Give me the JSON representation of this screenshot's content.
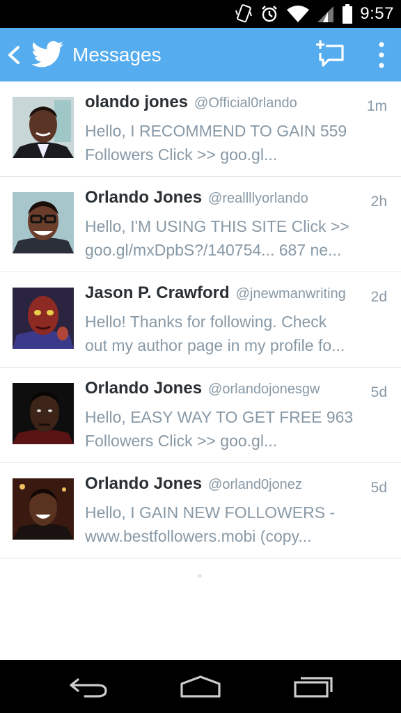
{
  "status_bar": {
    "time": "9:57",
    "icons": [
      "vibrate-icon",
      "alarm-icon",
      "wifi-icon",
      "signal-icon",
      "battery-icon"
    ]
  },
  "app_bar": {
    "title": "Messages",
    "back_icon": "back-chevron-icon",
    "logo_icon": "twitter-bird-icon",
    "compose_icon": "compose-message-icon",
    "overflow_icon": "overflow-menu-icon",
    "color": "#55acee"
  },
  "messages": [
    {
      "name": "olando jones",
      "handle": "@Official0rlando",
      "time": "1m",
      "preview_lines": [
        "Hello, I RECOMMEND TO GAIN 559",
        "Followers Click >> goo.gl..."
      ]
    },
    {
      "name": "Orlando Jones",
      "handle": "@reallllyorlando",
      "time": "2h",
      "preview_lines": [
        "Hello, I'M USING THIS SITE Click >>",
        "goo.gl/mxDpbS?/140754... 687 ne..."
      ]
    },
    {
      "name": "Jason P. Crawford",
      "handle": "@jnewmanwriting",
      "time": "2d",
      "preview_lines": [
        "Hello! Thanks for following. Check",
        "out my author page in my profile fo..."
      ]
    },
    {
      "name": "Orlando Jones",
      "handle": "@orlandojonesgw",
      "time": "5d",
      "preview_lines": [
        "Hello, EASY WAY TO GET FREE 963",
        "Followers Click >> goo.gl..."
      ]
    },
    {
      "name": "Orlando Jones",
      "handle": "@orland0jonez",
      "time": "5d",
      "preview_lines": [
        "Hello, I GAIN  NEW FOLLOWERS  -",
        "www.bestfollowers.mobi (copy..."
      ]
    }
  ],
  "nav_bar": {
    "icons": [
      "nav-back-icon",
      "nav-home-icon",
      "nav-recents-icon"
    ]
  }
}
